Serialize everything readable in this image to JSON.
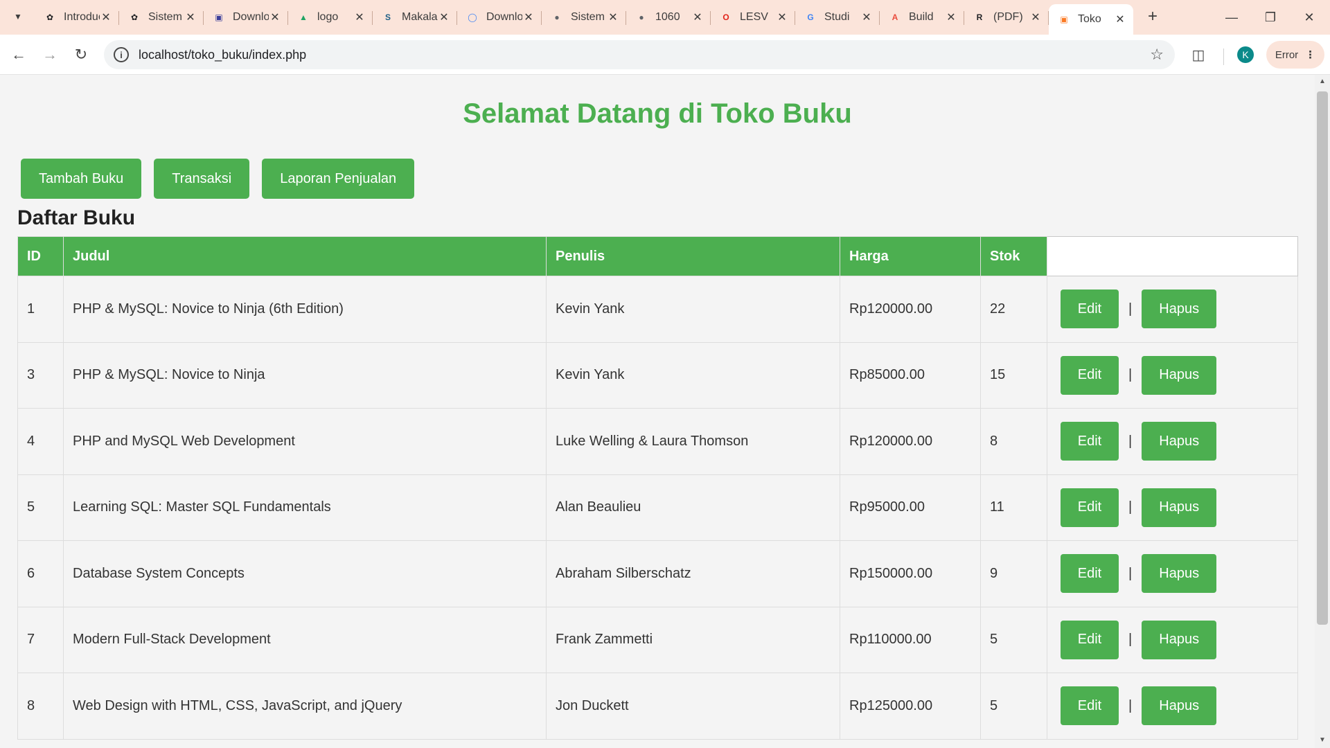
{
  "browser": {
    "tabs": [
      {
        "title": "Introduction",
        "icon": "openai-icon",
        "icon_color": "#202124",
        "active": false
      },
      {
        "title": "Sistem",
        "icon": "openai-icon",
        "icon_color": "#202124",
        "active": false
      },
      {
        "title": "Download",
        "icon": "document-icon",
        "icon_color": "#3b3e9a",
        "active": false
      },
      {
        "title": "logo",
        "icon": "google-drive-icon",
        "icon_color": "#1fa463",
        "active": false
      },
      {
        "title": "Makalah",
        "icon": "s-icon",
        "icon_color": "#1d5f86",
        "active": false
      },
      {
        "title": "Download",
        "icon": "circle-icon",
        "icon_color": "#4285f4",
        "active": false
      },
      {
        "title": "Sistem",
        "icon": "globe-icon",
        "icon_color": "#5f6368",
        "active": false
      },
      {
        "title": "1060",
        "icon": "globe-icon",
        "icon_color": "#5f6368",
        "active": false
      },
      {
        "title": "LESV",
        "icon": "o-icon",
        "icon_color": "#e2231a",
        "active": false
      },
      {
        "title": "Studi",
        "icon": "google-icon",
        "icon_color": "#4285f4",
        "active": false
      },
      {
        "title": "Build",
        "icon": "a-icon",
        "icon_color": "#e94b3c",
        "active": false
      },
      {
        "title": "(PDF)",
        "icon": "researchgate-icon",
        "icon_color": "#202124",
        "active": false
      },
      {
        "title": "Toko",
        "icon": "xampp-icon",
        "icon_color": "#fb7a24",
        "active": true
      }
    ],
    "url": "localhost/toko_buku/index.php",
    "profile_initial": "K",
    "error_label": "Error"
  },
  "page": {
    "title": "Selamat Datang di Toko Buku",
    "nav_buttons": [
      "Tambah Buku",
      "Transaksi",
      "Laporan Penjualan"
    ],
    "section_title": "Daftar Buku",
    "table": {
      "headers": [
        "ID",
        "Judul",
        "Penulis",
        "Harga",
        "Stok",
        ""
      ],
      "rows": [
        {
          "id": "1",
          "judul": "PHP & MySQL: Novice to Ninja (6th Edition)",
          "penulis": "Kevin Yank",
          "harga": "Rp120000.00",
          "stok": "22"
        },
        {
          "id": "3",
          "judul": "PHP & MySQL: Novice to Ninja",
          "penulis": "Kevin Yank",
          "harga": "Rp85000.00",
          "stok": "15"
        },
        {
          "id": "4",
          "judul": "PHP and MySQL Web Development",
          "penulis": "Luke Welling & Laura Thomson",
          "harga": "Rp120000.00",
          "stok": "8"
        },
        {
          "id": "5",
          "judul": "Learning SQL: Master SQL Fundamentals",
          "penulis": "Alan Beaulieu",
          "harga": "Rp95000.00",
          "stok": "11"
        },
        {
          "id": "6",
          "judul": "Database System Concepts",
          "penulis": "Abraham Silberschatz",
          "harga": "Rp150000.00",
          "stok": "9"
        },
        {
          "id": "7",
          "judul": "Modern Full-Stack Development",
          "penulis": "Frank Zammetti",
          "harga": "Rp110000.00",
          "stok": "5"
        },
        {
          "id": "8",
          "judul": "Web Design with HTML, CSS, JavaScript, and jQuery",
          "penulis": "Jon Duckett",
          "harga": "Rp125000.00",
          "stok": "5"
        }
      ],
      "edit_label": "Edit",
      "delete_label": "Hapus",
      "separator": "|"
    }
  },
  "colors": {
    "accent": "#4caf50",
    "tabstrip": "#fbe4da",
    "page_bg": "#f4f4f4"
  }
}
